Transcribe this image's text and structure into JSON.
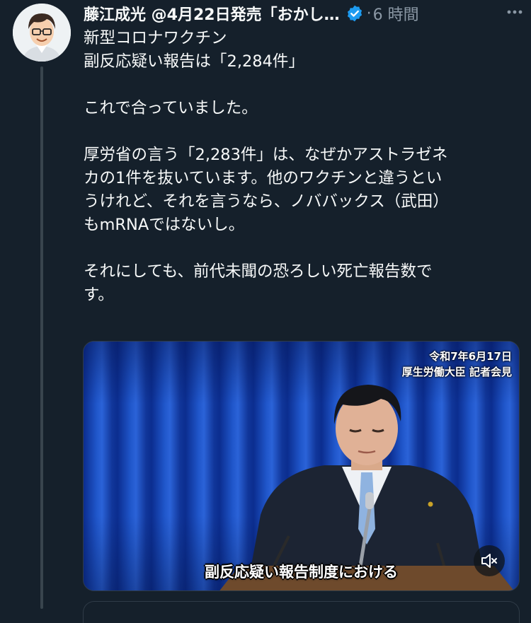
{
  "post": {
    "author_name": "藤江成光 @4月22日発売「おかし…",
    "separator": "·",
    "timestamp": "6 時間",
    "text_lines": [
      "新型コロナワクチン",
      "副反応疑い報告は「2,284件」",
      "",
      "これで合っていました。",
      "",
      "厚労省の言う「2,283件」は、なぜかアストラゼネ",
      "カの1件を抜いています。他のワクチンと違うとい",
      "うけれど、それを言うなら、ノババックス（武田）",
      "もmRNAではないし。",
      "",
      "それにしても、前代未聞の恐ろしい死亡報告数で",
      "す。"
    ]
  },
  "media": {
    "overlay_date": "令和7年6月17日",
    "overlay_title": "厚生労働大臣 記者会見",
    "caption": "副反応疑い報告制度における"
  },
  "icons": {
    "verified": "verified-badge-icon",
    "more": "more-horizontal-icon",
    "mute": "speaker-muted-icon"
  },
  "colors": {
    "background": "#15202b",
    "text": "#f7f9f9",
    "muted": "#8b98a5",
    "verified": "#1d9bf0",
    "curtain": "#1f55c9"
  }
}
